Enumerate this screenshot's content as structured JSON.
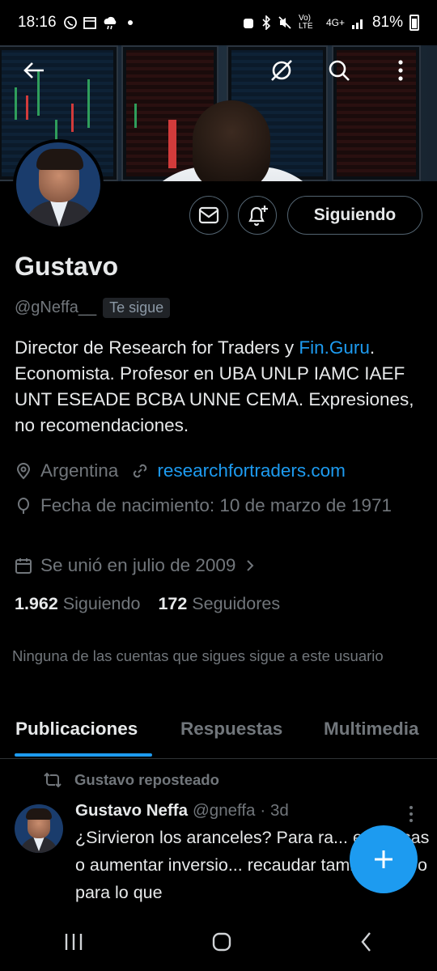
{
  "status_bar": {
    "time": "18:16",
    "left_icons": [
      "whatsapp-icon",
      "calendar-icon",
      "weather-icon",
      "dot-icon"
    ],
    "right_icons": [
      "alarm-icon",
      "bluetooth-icon",
      "mute-icon",
      "volte-icon",
      "4g-icon",
      "signal-icon"
    ],
    "volte_label": "Vo) LTE",
    "network_label": "4G+",
    "battery": "81%"
  },
  "header": {
    "back_icon": "arrow-left-icon",
    "grok_icon": "grok-icon",
    "search_icon": "search-icon",
    "more_icon": "more-vertical-icon"
  },
  "profile": {
    "name": "Gustavo",
    "handle": "@gNeffa__",
    "follows_you": "Te sigue",
    "follow_button": "Siguiendo",
    "bio_part1": "Director de Research for Traders y ",
    "bio_link": "Fin.Guru",
    "bio_part2": ". Economista. Profesor en UBA UNLP IAMC IAEF UNT ESEADE BCBA UNNE CEMA. Expresiones, no recomendaciones.",
    "location": "Argentina",
    "website": "researchfortraders.com",
    "birthday": "Fecha de nacimiento: 10 de marzo de 1971",
    "joined": "Se unió en julio de 2009",
    "following_count": "1.962",
    "following_label": "Siguiendo",
    "followers_count": "172",
    "followers_label": "Seguidores",
    "mutuals_note": "Ninguna de las cuentas que sigues sigue a este usuario"
  },
  "tabs": [
    "Publicaciones",
    "Respuestas",
    "Multimedia"
  ],
  "active_tab": "Publicaciones",
  "tweet": {
    "repost_label": "Gustavo reposteado",
    "author_name": "Gustavo Neffa",
    "author_handle": "@gneffa",
    "time": "· 3d",
    "text": "¿Sirvieron los aranceles? Para ra... empresas o aumentar inversio... recaudar también, pero para lo que"
  },
  "fab": {
    "icon": "plus-icon"
  },
  "nav": {
    "icons": [
      "recent-apps-icon",
      "home-icon",
      "back-icon"
    ]
  },
  "colors": {
    "background": "#000000",
    "accent": "#1d9bf0",
    "text_primary": "#e7e9ea",
    "text_secondary": "#71767b",
    "border": "#536471"
  }
}
